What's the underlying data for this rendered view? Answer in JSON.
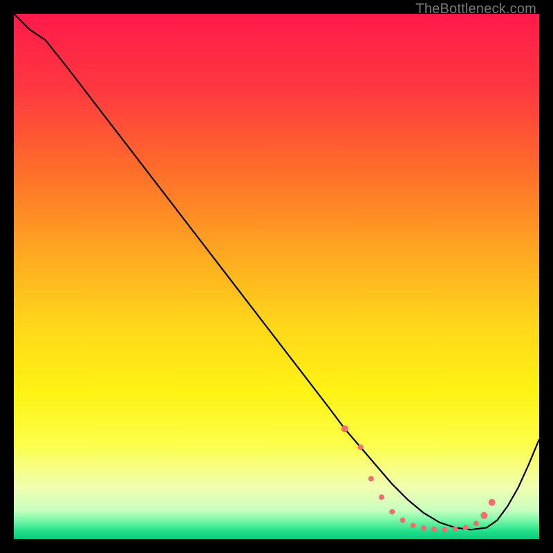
{
  "watermark": "TheBottleneck.com",
  "chart_data": {
    "type": "line",
    "title": "",
    "xlabel": "",
    "ylabel": "",
    "xlim": [
      0,
      100
    ],
    "ylim": [
      0,
      100
    ],
    "grid": false,
    "legend": false,
    "background_gradient": {
      "stops": [
        {
          "offset": 0.0,
          "color": "#ff1a4b"
        },
        {
          "offset": 0.15,
          "color": "#ff3a3f"
        },
        {
          "offset": 0.3,
          "color": "#ff6e2a"
        },
        {
          "offset": 0.45,
          "color": "#ffa621"
        },
        {
          "offset": 0.6,
          "color": "#ffd91a"
        },
        {
          "offset": 0.72,
          "color": "#fff314"
        },
        {
          "offset": 0.82,
          "color": "#fcff4a"
        },
        {
          "offset": 0.9,
          "color": "#f1ffb0"
        },
        {
          "offset": 0.945,
          "color": "#c9ffc0"
        },
        {
          "offset": 0.965,
          "color": "#77f7a6"
        },
        {
          "offset": 0.985,
          "color": "#1fe08a"
        },
        {
          "offset": 1.0,
          "color": "#0cc97a"
        }
      ]
    },
    "series": [
      {
        "name": "bottleneck-curve",
        "color": "#000000",
        "x": [
          0,
          3,
          6,
          10,
          15,
          20,
          25,
          30,
          35,
          40,
          45,
          50,
          55,
          60,
          63,
          66,
          69,
          72,
          75,
          78,
          81,
          84,
          87,
          90,
          92,
          94,
          96,
          98,
          100
        ],
        "y": [
          100,
          97,
          95,
          90,
          83.5,
          77,
          70.5,
          64,
          57.5,
          51,
          44.5,
          38,
          31.5,
          25,
          21,
          17.5,
          14,
          10.5,
          7.5,
          5,
          3.2,
          2.2,
          1.8,
          2.2,
          3.6,
          6.3,
          9.8,
          14.2,
          19
        ]
      }
    ],
    "markers": {
      "name": "highlight-dots",
      "color": "#ef6f70",
      "points": [
        {
          "x": 63,
          "y": 21,
          "r": 5
        },
        {
          "x": 66,
          "y": 17.5,
          "r": 4
        },
        {
          "x": 68,
          "y": 11.5,
          "r": 4
        },
        {
          "x": 70,
          "y": 8.0,
          "r": 4
        },
        {
          "x": 72,
          "y": 5.2,
          "r": 4
        },
        {
          "x": 74,
          "y": 3.6,
          "r": 4
        },
        {
          "x": 76,
          "y": 2.6,
          "r": 4
        },
        {
          "x": 78,
          "y": 2.1,
          "r": 4
        },
        {
          "x": 80,
          "y": 1.9,
          "r": 4
        },
        {
          "x": 82,
          "y": 1.8,
          "r": 4
        },
        {
          "x": 84,
          "y": 1.9,
          "r": 4
        },
        {
          "x": 86,
          "y": 2.2,
          "r": 4
        },
        {
          "x": 88,
          "y": 3.0,
          "r": 4
        },
        {
          "x": 89.5,
          "y": 4.5,
          "r": 5
        },
        {
          "x": 91,
          "y": 7.0,
          "r": 5
        }
      ]
    }
  }
}
